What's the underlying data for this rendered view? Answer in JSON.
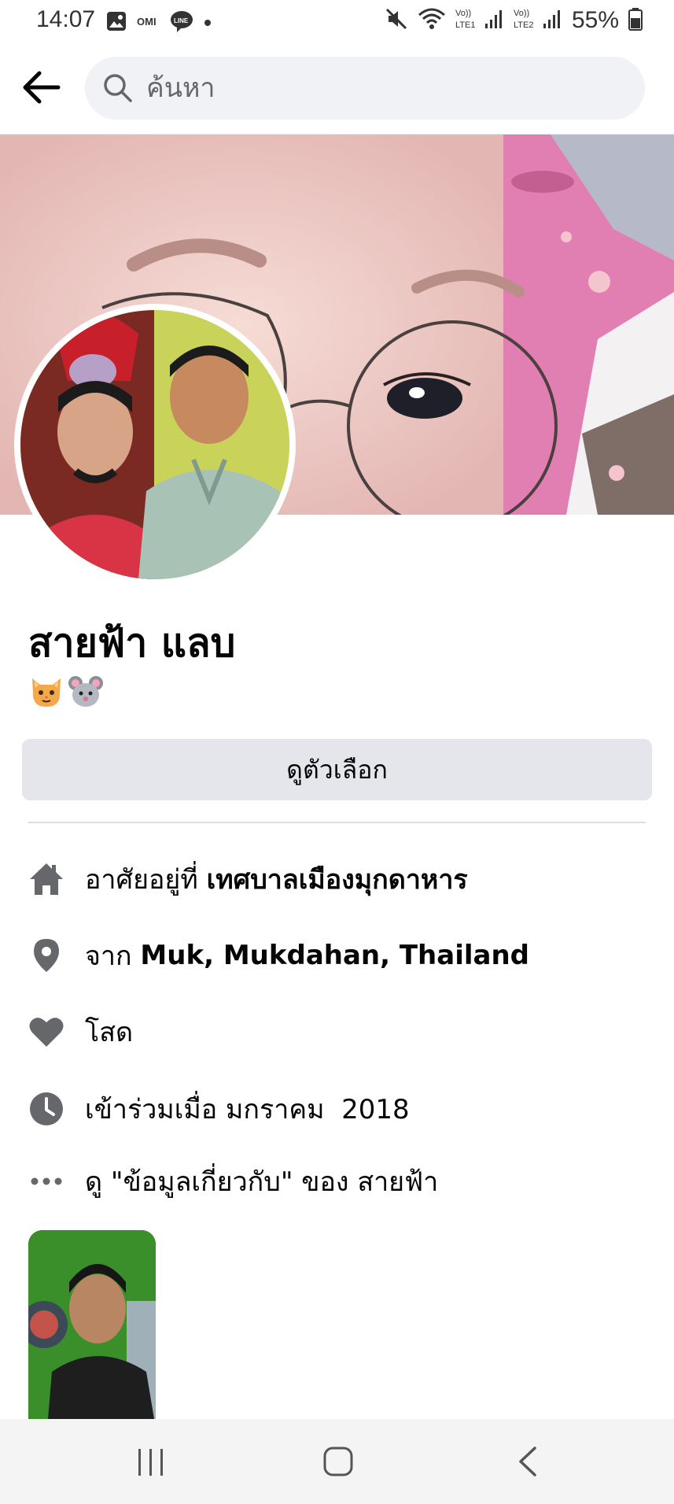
{
  "status_bar": {
    "time": "14:07",
    "battery_percent": "55%",
    "left_icons": [
      "gallery-icon",
      "omi-icon",
      "line-icon",
      "dot-icon"
    ],
    "right_icons": [
      "mute-icon",
      "wifi-icon",
      "volte1-signal-icon",
      "volte2-signal-icon",
      "battery-icon"
    ]
  },
  "search": {
    "placeholder": "ค้นหา"
  },
  "profile": {
    "name": "สายฟ้า แลบ",
    "bio_emojis": [
      "cat-face-emoji",
      "mouse-face-emoji"
    ]
  },
  "actions": {
    "see_options_label": "ดูตัวเลือก"
  },
  "details": {
    "lives_in_label": "อาศัยอยู่ที่ ",
    "lives_in_value": "เทศบาลเมืองมุกดาหาร",
    "from_label": "จาก ",
    "from_value": "Muk, Mukdahan, Thailand",
    "relationship": "โสด",
    "joined": "เข้าร่วมเมื่อ มกราคม  2018",
    "see_about": "ดู \"ข้อมูลเกี่ยวกับ\" ของ สายฟ้า"
  },
  "colors": {
    "accent_text": "#050505",
    "secondary_text": "#65676b",
    "icon_gray": "#65676b",
    "button_bg": "#e4e6eb",
    "search_bg": "#f0f2f5"
  }
}
